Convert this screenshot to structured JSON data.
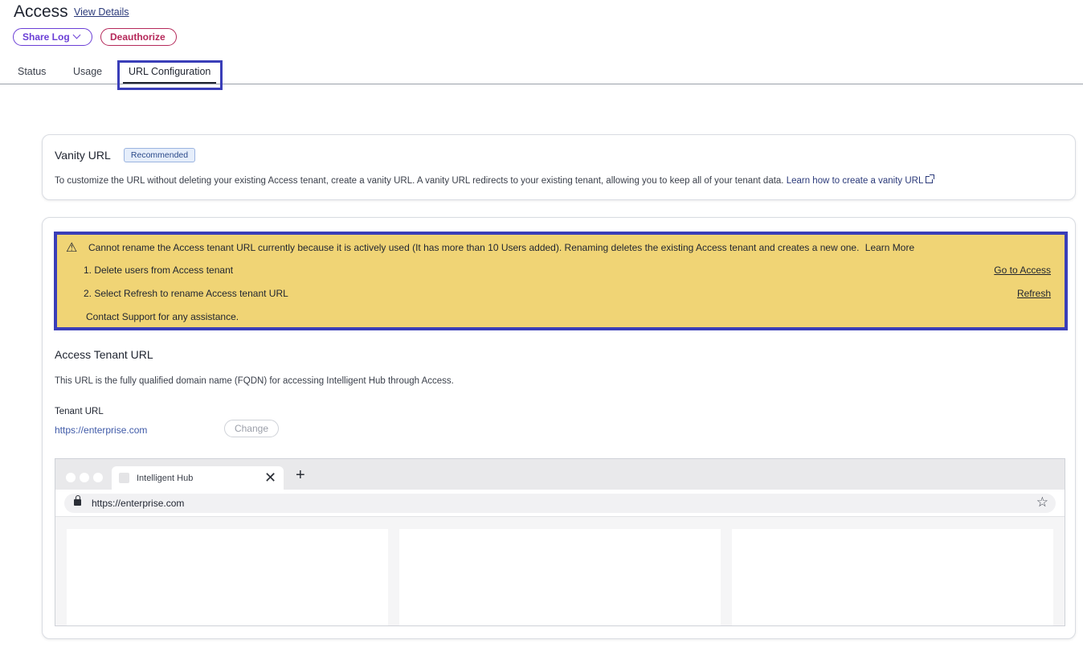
{
  "header": {
    "title": "Access",
    "view_details": "View Details",
    "share_log": "Share Log",
    "deauthorize": "Deauthorize"
  },
  "tabs": [
    {
      "label": "Status"
    },
    {
      "label": "Usage"
    },
    {
      "label": "URL Configuration",
      "active": true
    }
  ],
  "vanity": {
    "title": "Vanity URL",
    "badge": "Recommended",
    "description": "To customize the URL without deleting your existing Access tenant, create a vanity URL. A vanity URL redirects to your existing tenant, allowing you to keep all of your tenant data.",
    "link": "Learn how to create a vanity URL"
  },
  "warning": {
    "icon": "warning-triangle-icon",
    "message": "Cannot rename the Access tenant URL currently because it is actively used (It has more than 10 Users added). Renaming deletes the existing Access tenant and creates a new one.",
    "learn_more": "Learn More",
    "step1": "1. Delete users from Access tenant",
    "step1_link": "Go to Access",
    "step2": "2. Select Refresh to rename Access tenant URL",
    "step2_link": "Refresh",
    "contact": "Contact Support  for any assistance.",
    "background": "#f0d475"
  },
  "tenant": {
    "title": "Access Tenant URL",
    "description": "This URL is the fully qualified domain name (FQDN) for accessing Intelligent Hub through Access.",
    "label": "Tenant URL",
    "value": "https://enterprise.com",
    "change": "Change"
  },
  "browser_preview": {
    "tab_title": "Intelligent Hub",
    "address": "https://enterprise.com",
    "close_glyph": "✕",
    "new_tab_glyph": "+",
    "star_glyph": "☆"
  },
  "colors": {
    "accent_purple": "#6b3fd6",
    "danger": "#b5295a",
    "highlight_border": "#3a3eb8",
    "link": "#2b3a7a"
  }
}
